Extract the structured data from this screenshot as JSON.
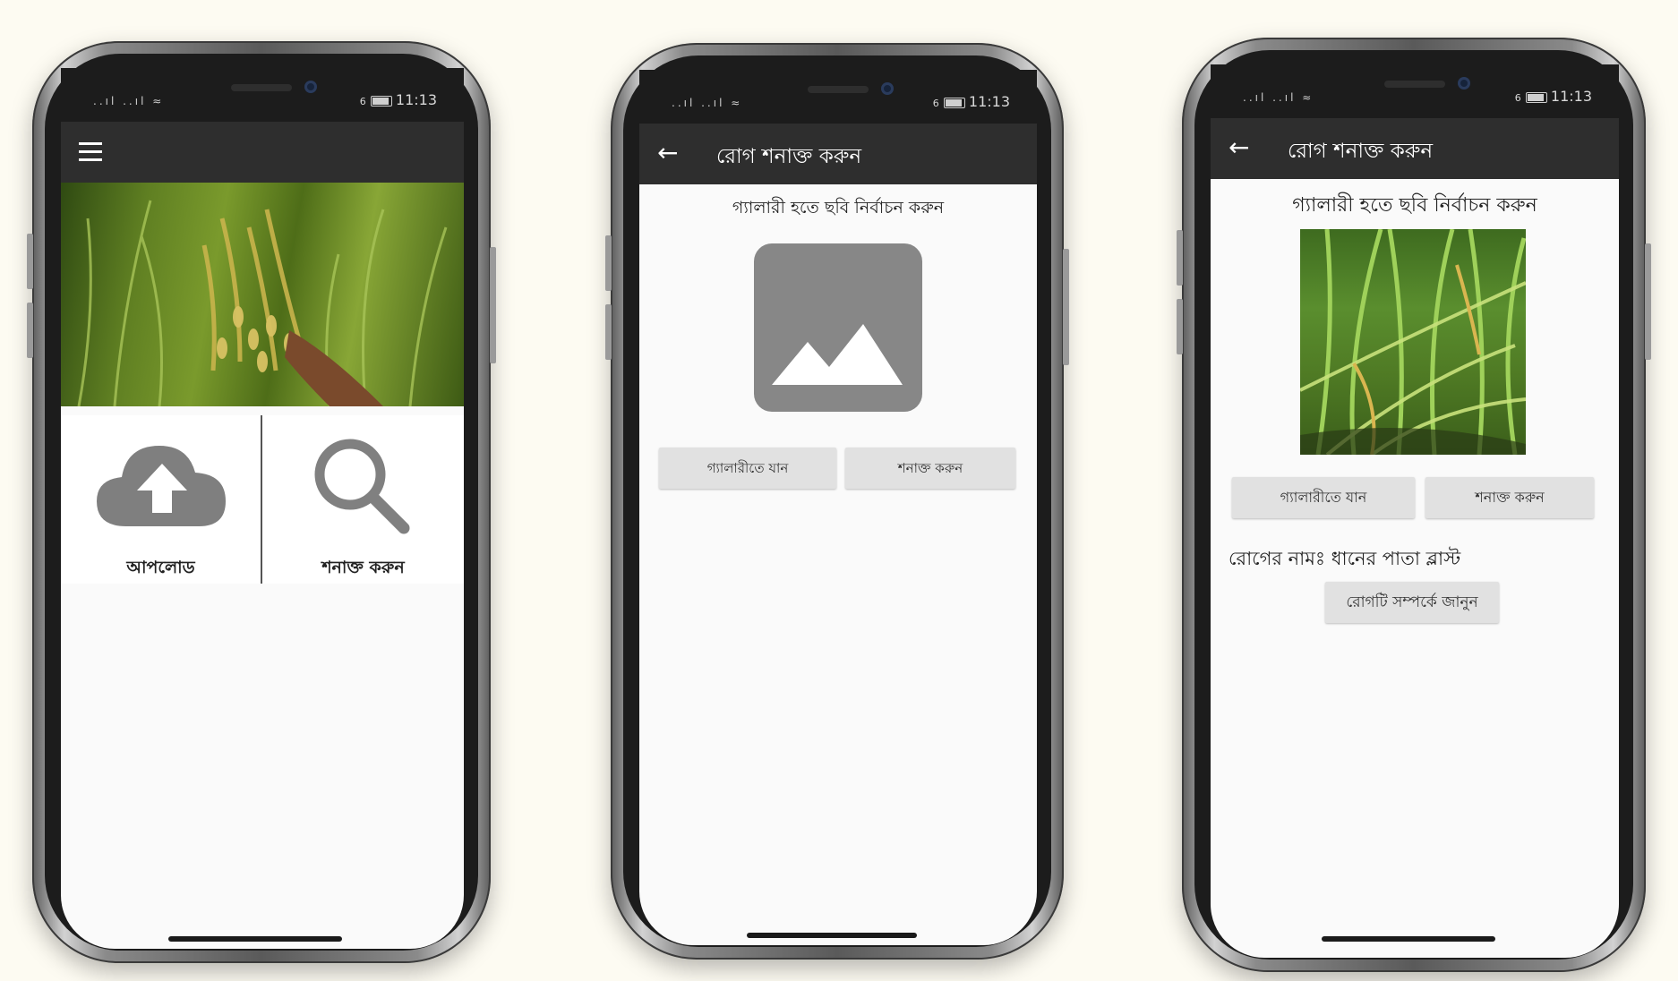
{
  "status_bar": {
    "time": "11:13",
    "signal": "..ıl ..ıl ≈",
    "battery_level_label": "6"
  },
  "screen1": {
    "menu_icon": "hamburger-icon",
    "hero_image_desc": "rice-paddy",
    "tiles": [
      {
        "label": "আপলোড",
        "icon": "cloud-upload-icon"
      },
      {
        "label": "শনাক্ত করুন",
        "icon": "search-icon"
      }
    ]
  },
  "screen2": {
    "title": "রোগ শনাক্ত করুন",
    "subtitle": "গ্যালারী হতে ছবি নির্বাচন করুন",
    "placeholder_icon": "image-placeholder-icon",
    "gallery_button": "গ্যালারীতে যান",
    "detect_button": "শনাক্ত করুন"
  },
  "screen3": {
    "title": "রোগ শনাক্ত করুন",
    "subtitle": "গ্যালারী হতে ছবি নির্বাচন করুন",
    "gallery_button": "গ্যালারীতে যান",
    "detect_button": "শনাক্ত করুন",
    "disease_label": "রোগের নামঃ ধানের পাতা ব্লাস্ট",
    "learn_button": "রোগটি সম্পর্কে জানুন"
  },
  "colors": {
    "app_bar": "#2e2e2e",
    "status_bar": "#1c1c1c",
    "icon_gray": "#808080",
    "button_gray": "#e1e1e1"
  }
}
